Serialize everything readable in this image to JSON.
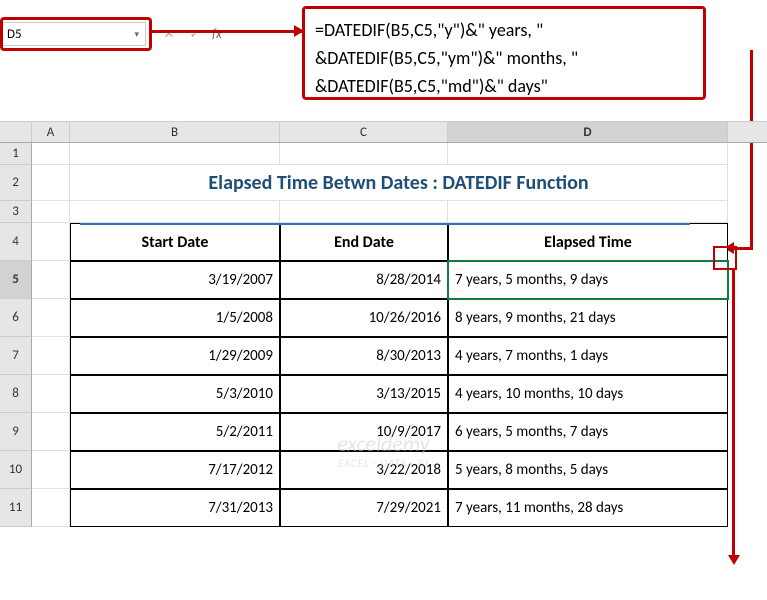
{
  "formula_bar": {
    "name_box": "D5",
    "dropdown_glyph": "▾",
    "cancel_glyph": "✕",
    "enter_glyph": "✓",
    "fx_label": "fx",
    "line1": "=DATEDIF(B5,C5,\"y\")&\" years, \"",
    "line2": "&DATEDIF(B5,C5,\"ym\")&\" months, \"",
    "line3": "&DATEDIF(B5,C5,\"md\")&\" days\""
  },
  "columns": {
    "a": "A",
    "b": "B",
    "c": "C",
    "d": "D"
  },
  "row_nums": {
    "r1": "1",
    "r2": "2",
    "r3": "3",
    "r4": "4",
    "r5": "5",
    "r6": "6",
    "r7": "7",
    "r8": "8",
    "r9": "9",
    "r10": "10",
    "r11": "11"
  },
  "title": "Elapsed Time Betwn Dates : DATEDIF Function",
  "headers": {
    "start": "Start Date",
    "end": "End Date",
    "elapsed": "Elapsed Time"
  },
  "rows": [
    {
      "start": "3/19/2007",
      "end": "8/28/2014",
      "elapsed": "7 years, 5 months, 9 days"
    },
    {
      "start": "1/5/2008",
      "end": "10/26/2016",
      "elapsed": "8 years, 9 months, 21 days"
    },
    {
      "start": "1/29/2009",
      "end": "8/30/2013",
      "elapsed": "4 years, 7 months, 1 days"
    },
    {
      "start": "5/3/2010",
      "end": "3/13/2015",
      "elapsed": "4 years, 10 months, 10 days"
    },
    {
      "start": "5/2/2011",
      "end": "10/9/2017",
      "elapsed": "6 years, 5 months, 7 days"
    },
    {
      "start": "7/17/2012",
      "end": "3/22/2018",
      "elapsed": "5 years, 8 months, 5 days"
    },
    {
      "start": "7/31/2013",
      "end": "7/29/2021",
      "elapsed": "7 years, 11 months, 28 days"
    }
  ],
  "watermark": {
    "main": "exceldemy",
    "sub": "EXCEL · DATA · BI"
  },
  "colors": {
    "annotation": "#c00000",
    "selection": "#107c41",
    "title": "#1f4e79"
  }
}
